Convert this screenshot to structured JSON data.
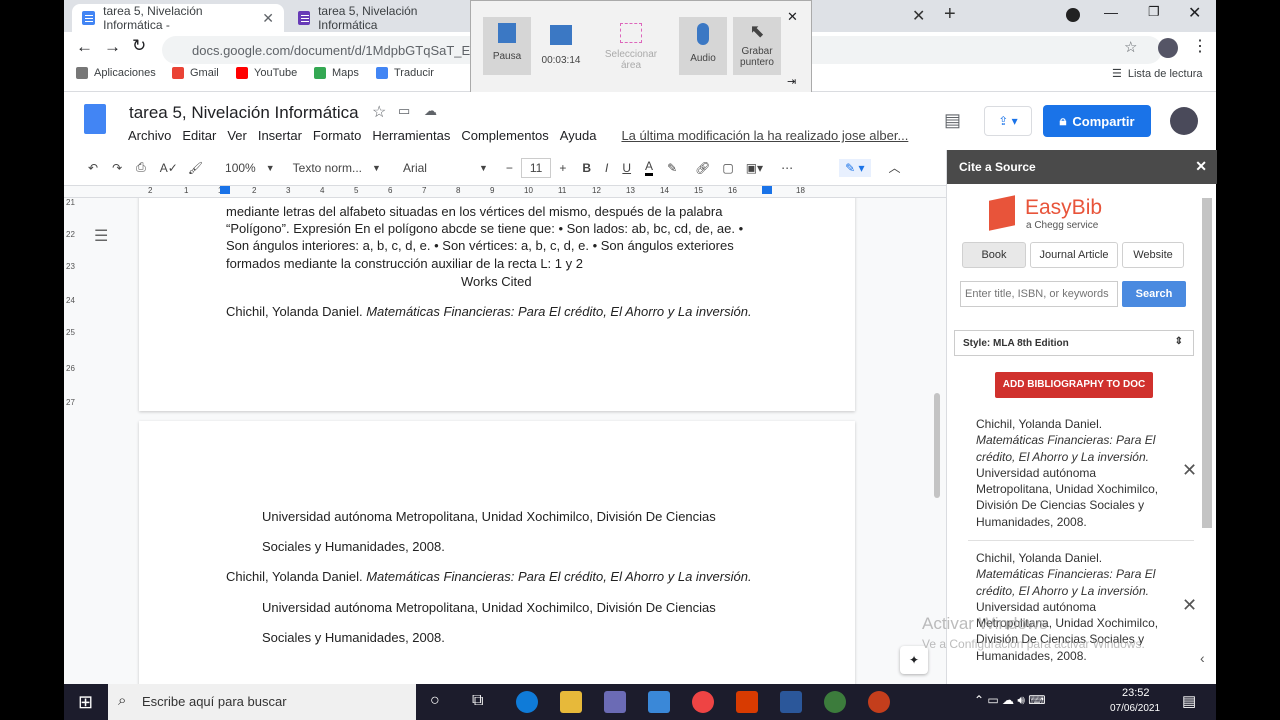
{
  "browser": {
    "tabs": [
      {
        "title": "tarea 5, Nivelación Informática -",
        "color": "#4285f4"
      },
      {
        "title": "tarea 5, Nivelación Informática",
        "color": "#673ab7"
      }
    ],
    "url": "docs.google.com/document/d/1MdpbGTqSaT_E8...",
    "bookmarks": [
      {
        "label": "Aplicaciones",
        "color": "#777"
      },
      {
        "label": "Gmail",
        "color": "#ea4335"
      },
      {
        "label": "YouTube",
        "color": "#ff0000"
      },
      {
        "label": "Maps",
        "color": "#34a853"
      },
      {
        "label": "Traducir",
        "color": "#4285f4"
      }
    ],
    "reading_list": "Lista de lectura"
  },
  "recorder": {
    "pause": "Pausa",
    "time": "00:03:14",
    "select_area": "Seleccionar área",
    "audio": "Audio",
    "record_pointer": "Grabar puntero"
  },
  "docs": {
    "title": "tarea 5, Nivelación Informática",
    "menus": [
      "Archivo",
      "Editar",
      "Ver",
      "Insertar",
      "Formato",
      "Herramientas",
      "Complementos",
      "Ayuda"
    ],
    "last_edit": "La última modificación la ha realizado jose alber...",
    "share": "Compartir"
  },
  "toolbar": {
    "zoom": "100%",
    "style": "Texto norm...",
    "font": "Arial",
    "size": "11"
  },
  "ruler": {
    "ticks": [
      "2",
      "1",
      "1",
      "2",
      "3",
      "4",
      "5",
      "6",
      "7",
      "8",
      "9",
      "10",
      "11",
      "12",
      "13",
      "14",
      "15",
      "16",
      "17",
      "18"
    ],
    "side": [
      "21",
      "22",
      "23",
      "24",
      "25",
      "26",
      "27"
    ]
  },
  "page1": {
    "lines": [
      "mediante letras del alfabeto situadas en los vértices del mismo, después de la palabra",
      "“Polígono”. Expresión En el polígono abcde se tiene que: • Son lados: ab, bc, cd, de, ae. •",
      "Son ángulos interiores: a, b, c, d, e. • Son vértices: a, b, c, d, e. • Son ángulos exteriores",
      "formados mediante la construcción auxiliar de la recta L: 1 y 2"
    ],
    "works_cited": "Works Cited",
    "cite_author": "Chichil, Yolanda Daniel. ",
    "cite_title": "Matemáticas Financieras: Para El crédito, El Ahorro y La inversión."
  },
  "page2": {
    "l1": "Universidad autónoma Metropolitana, Unidad Xochimilco, División De Ciencias",
    "l2": "Sociales y Humanidades, 2008.",
    "author": "Chichil, Yolanda Daniel. ",
    "title": "Matemáticas Financieras: Para El crédito, El Ahorro y La inversión.",
    "l3": "Universidad autónoma Metropolitana, Unidad Xochimilco, División De Ciencias",
    "l4": "Sociales y Humanidades, 2008."
  },
  "sidebar": {
    "header": "Cite a Source",
    "brand": "EasyBib",
    "brand_sub": "a Chegg service",
    "tabs": [
      "Book",
      "Journal Article",
      "Website"
    ],
    "search_placeholder": "Enter title, ISBN, or keywords",
    "search_btn": "Search",
    "style": "Style: MLA 8th Edition",
    "add_btn": "ADD BIBLIOGRAPHY TO DOC",
    "citations": [
      {
        "author": "Chichil, Yolanda Daniel.",
        "title": "Matemáticas Financieras: Para El crédito, El Ahorro y La inversión.",
        "rest": "Universidad autónoma Metropolitana, Unidad Xochimilco, División De Ciencias Sociales y Humanidades, 2008."
      },
      {
        "author": "Chichil, Yolanda Daniel.",
        "title": "Matemáticas Financieras: Para El crédito, El Ahorro y La inversión.",
        "rest": "Universidad autónoma Metropolitana, Unidad Xochimilco, División De Ciencias Sociales y Humanidades, 2008."
      }
    ]
  },
  "watermark": {
    "l1": "Activar Windows",
    "l2": "Ve a Configuración para activar Windows."
  },
  "taskbar": {
    "search": "Escribe aquí para buscar",
    "time": "23:52",
    "date": "07/06/2021"
  }
}
